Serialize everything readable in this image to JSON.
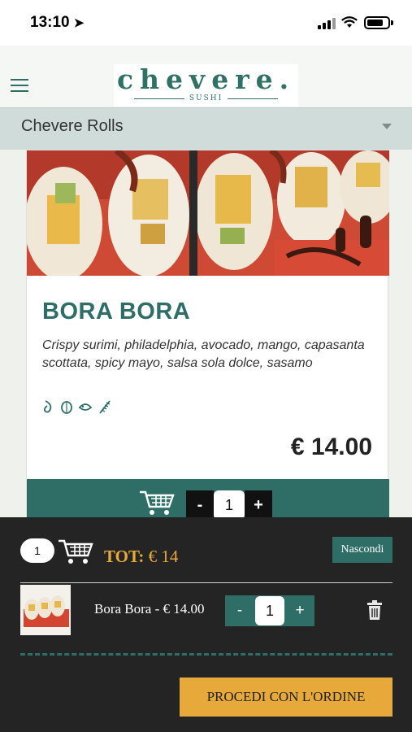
{
  "status_bar": {
    "time": "13:10",
    "location_icon": "location-arrow-icon"
  },
  "header": {
    "menu_icon": "hamburger-menu-icon",
    "logo_name": "chevere.",
    "logo_sub": "SUSHI"
  },
  "category": {
    "selected": "Chevere Rolls"
  },
  "product": {
    "name": "BORA BORA",
    "description": "Crispy surimi, philadelphia, avocado, mango, capasanta scottata, spicy mayo, salsa sola dolce, sasamo",
    "allergen_icons": [
      "allergen-icon-1",
      "allergen-icon-2",
      "allergen-icon-3",
      "allergen-icon-4"
    ],
    "price": "€ 14.00",
    "qty_minus": "-",
    "qty_value": "1",
    "qty_plus": "+"
  },
  "cart": {
    "count": "1",
    "total_label": "TOT:",
    "total_value": "€ 14",
    "hide_label": "Nascondi",
    "item_title": "Bora Bora - € 14.00",
    "item_minus": "-",
    "item_qty": "1",
    "item_plus": "+",
    "order_button": "PROCEDI CON L'ORDINE"
  },
  "colors": {
    "accent": "#2e6e66",
    "gold": "#e6a93a",
    "overlay": "#242424"
  }
}
